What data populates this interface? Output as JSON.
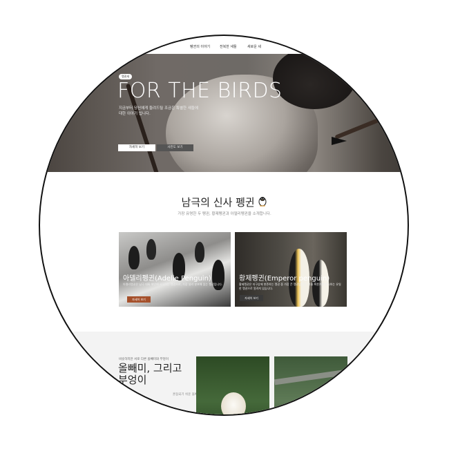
{
  "nav": {
    "items": [
      "펭귄의 이야기",
      "전복한 새들",
      "새로운 세"
    ]
  },
  "hero": {
    "badge": "펭귄새",
    "title": "FOR THE BIRDS",
    "description": "지금부터 당신에게 들려드릴 조금은 특별한 새들에 대한 이야기 입니다.",
    "primary_button": "자세히 보기",
    "secondary_button": "사진도 보기",
    "slide_count": 4,
    "active_slide": 3
  },
  "penguins": {
    "title": "남극의 신사 펭귄",
    "subtitle": "가장 유명한 두 펭귄, 황제펭귄과 아델리펭귄을 소개합니다.",
    "cards": [
      {
        "title": "아델리펭귄(Adelie Penguin)",
        "text": "아델리펭귄은 남극 대륙 해안에 서식하는 펭귄으로, 가장 널리 분포해 있는 펭귄입니다.",
        "button": "자세히 보기"
      },
      {
        "title": "황제펭귄(Emperor penguin)",
        "text": "황제펭귄은 지구상에 현존하는 펭귄 중 가장 큰 펭귄입니다. 겨울 혹한기에 번식하는 유일한 펭귄으로 알려져 있습니다.",
        "button": "자세히 보기"
      }
    ]
  },
  "owls": {
    "kicker": "비슷하지만 서로 다른 올빼미와 부엉이",
    "title": "올빼미, 그리고 부엉이",
    "text": "혼동되기 쉬운 올빼미와 부엉이, 그 차이를 알아보자 뭐"
  },
  "colors": {
    "accent": "#a5502b",
    "dark_button": "#3a3a3a",
    "section_bg": "#f3f3f3"
  }
}
